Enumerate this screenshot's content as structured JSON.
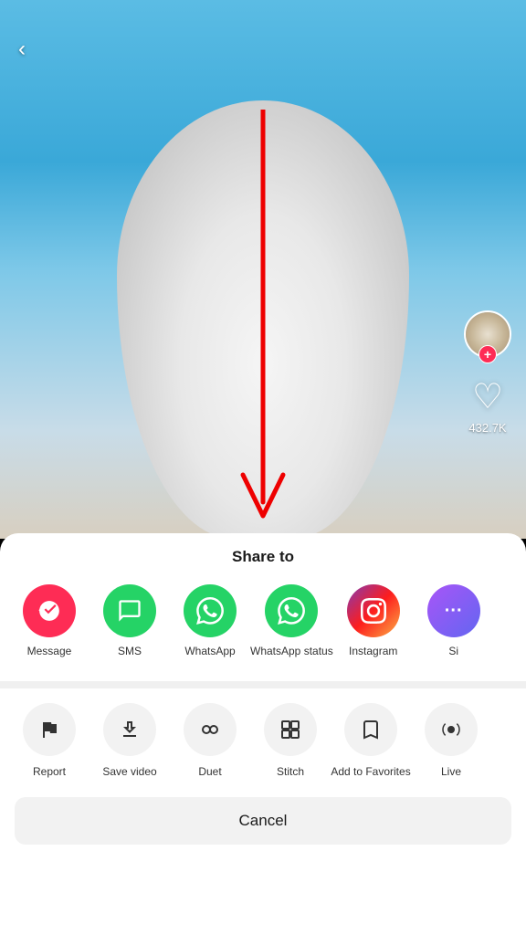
{
  "video": {
    "background_color_top": "#5bbce4",
    "background_color_bottom": "#c8dce8"
  },
  "header": {
    "back_label": "‹"
  },
  "right_actions": {
    "plus_badge": "+",
    "heart_count": "432.7K"
  },
  "share_panel": {
    "title": "Share to",
    "apps": [
      {
        "id": "message",
        "label": "Message",
        "color_class": "icon-message",
        "icon": "✈"
      },
      {
        "id": "sms",
        "label": "SMS",
        "color_class": "icon-sms",
        "icon": "💬"
      },
      {
        "id": "whatsapp",
        "label": "WhatsApp",
        "color_class": "icon-whatsapp",
        "icon": "W"
      },
      {
        "id": "whatsapp-status",
        "label": "WhatsApp status",
        "color_class": "icon-whatsapp-status",
        "icon": "W"
      },
      {
        "id": "instagram",
        "label": "Instagram",
        "color_class": "icon-instagram",
        "icon": "📷"
      },
      {
        "id": "more",
        "label": "Sì",
        "color_class": "icon-more",
        "icon": "⋯"
      }
    ],
    "actions": [
      {
        "id": "report",
        "label": "Report",
        "icon": "⚑"
      },
      {
        "id": "save-video",
        "label": "Save video",
        "icon": "↓"
      },
      {
        "id": "duet",
        "label": "Duet",
        "icon": "◎"
      },
      {
        "id": "stitch",
        "label": "Stitch",
        "icon": "⊞"
      },
      {
        "id": "add-favorites",
        "label": "Add to Favorites",
        "icon": "🔖"
      },
      {
        "id": "live",
        "label": "Live",
        "icon": "◉"
      }
    ],
    "cancel_label": "Cancel"
  }
}
